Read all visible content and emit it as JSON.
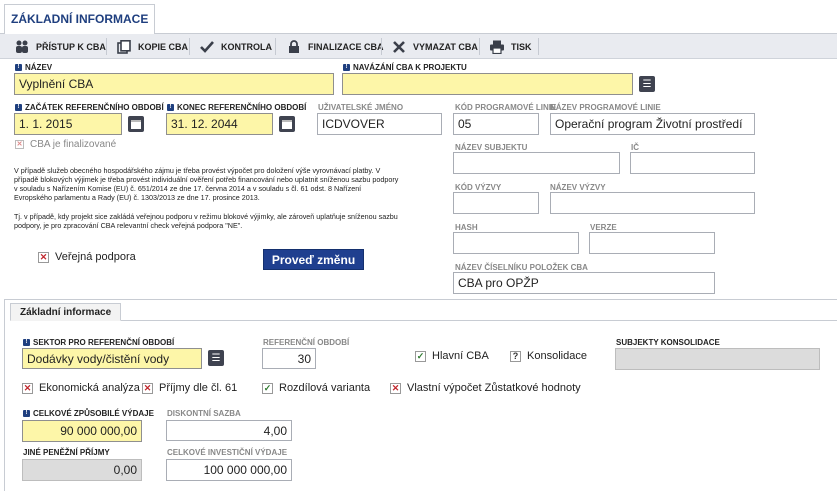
{
  "header": {
    "tab_title": "ZÁKLADNÍ INFORMACE"
  },
  "toolbar": {
    "items": [
      {
        "label": "PŘÍSTUP K CBA",
        "icon": "users-icon"
      },
      {
        "label": "KOPIE CBA",
        "icon": "copy-icon"
      },
      {
        "label": "KONTROLA",
        "icon": "check-icon"
      },
      {
        "label": "FINALIZACE CBA",
        "icon": "lock-icon"
      },
      {
        "label": "VYMAZAT CBA",
        "icon": "delete-icon"
      },
      {
        "label": "TISK",
        "icon": "print-icon"
      }
    ]
  },
  "form": {
    "nazev_label": "NÁZEV",
    "nazev_value": "Vyplnění CBA",
    "navazani_label": "NAVÁZÁNÍ CBA K PROJEKTU",
    "navazani_value": "",
    "zacatek_label": "ZAČÁTEK REFERENČNÍHO OBDOBÍ",
    "zacatek_value": "1. 1. 2015",
    "konec_label": "KONEC REFERENČNÍHO OBDOBÍ",
    "konec_value": "31. 12. 2044",
    "uzivatel_label": "UŽIVATELSKÉ JMÉNO",
    "uzivatel_value": "ICDVOVER",
    "kod_prog_label": "KÓD PROGRAMOVÉ LINIE",
    "kod_prog_value": "05",
    "nazev_prog_label": "NÁZEV PROGRAMOVÉ LINIE",
    "nazev_prog_value": "Operační program Životní prostředí",
    "finalizovano_label": "CBA je finalizované",
    "nazev_subjektu_label": "NÁZEV SUBJEKTU",
    "nazev_subjektu_value": "",
    "ic_label": "IČ",
    "ic_value": "",
    "kod_vyzvy_label": "KÓD VÝZVY",
    "kod_vyzvy_value": "",
    "nazev_vyzvy_label": "NÁZEV VÝZVY",
    "nazev_vyzvy_value": "",
    "hash_label": "HASH",
    "hash_value": "",
    "verze_label": "VERZE",
    "verze_value": "",
    "ciselnik_label": "NÁZEV ČÍSELNÍKU POLOŽEK CBA",
    "ciselnik_value": "CBA pro OPŽP",
    "note1": "V případě služeb obecného hospodářského zájmu je třeba provést výpočet pro doložení výše vyrovnávací platby. V případě blokových výjimek je třeba provést individuální ověření potřeb financování nebo uplatnit sníženou sazbu podpory v souladu s Nařízením Komise (EU) č. 651/2014 ze dne 17. června 2014 a v souladu s čl. 61 odst. 8 Nařízení Evropského parlamentu a Rady (EU) č. 1303/2013 ze dne 17. prosince 2013.",
    "note2": "Tj. v případě, kdy projekt sice zakládá veřejnou podporu v režimu blokové výjimky, ale zároveň uplatňuje sníženou sazbu podpory, je pro zpracování CBA relevantní check veřejná podpora \"NE\".",
    "verejna_podpora_label": "Veřejná podpora",
    "proved_zmenu_label": "Proveď změnu"
  },
  "lower": {
    "tab_label": "Základní informace",
    "sektor_label": "SEKTOR PRO REFERENČNÍ OBDOBÍ",
    "sektor_value": "Dodávky vody/čistění vody",
    "ref_obdobi_label": "REFERENČNÍ OBDOBÍ",
    "ref_obdobi_value": "30",
    "hlavni_cba_label": "Hlavní CBA",
    "konsolidace_label": "Konsolidace",
    "subjekty_label": "SUBJEKTY KONSOLIDACE",
    "subjekty_value": "",
    "ekonomicka_label": "Ekonomická analýza",
    "prijmy_label": "Příjmy dle čl. 61",
    "rozdilova_label": "Rozdílová varianta",
    "vlastni_label": "Vlastní výpočet Zůstatkové hodnoty",
    "celkove_label": "CELKOVÉ ZPŮSOBILÉ VÝDAJE",
    "celkove_value": "90 000 000,00",
    "diskontni_label": "DISKONTNÍ SAZBA",
    "diskontni_value": "4,00",
    "jine_label": "JINÉ PENĚŽNÍ PŘÍJMY",
    "jine_value": "0,00",
    "investicni_label": "CELKOVÉ INVESTIČNÍ VÝDAJE",
    "investicni_value": "100 000 000,00"
  },
  "colors": {
    "required_fill": "#fdf6a8",
    "accent": "#1f3f8f",
    "toolbar_bg": "#e9ebf0",
    "uncheck_red": "#c0272d"
  }
}
